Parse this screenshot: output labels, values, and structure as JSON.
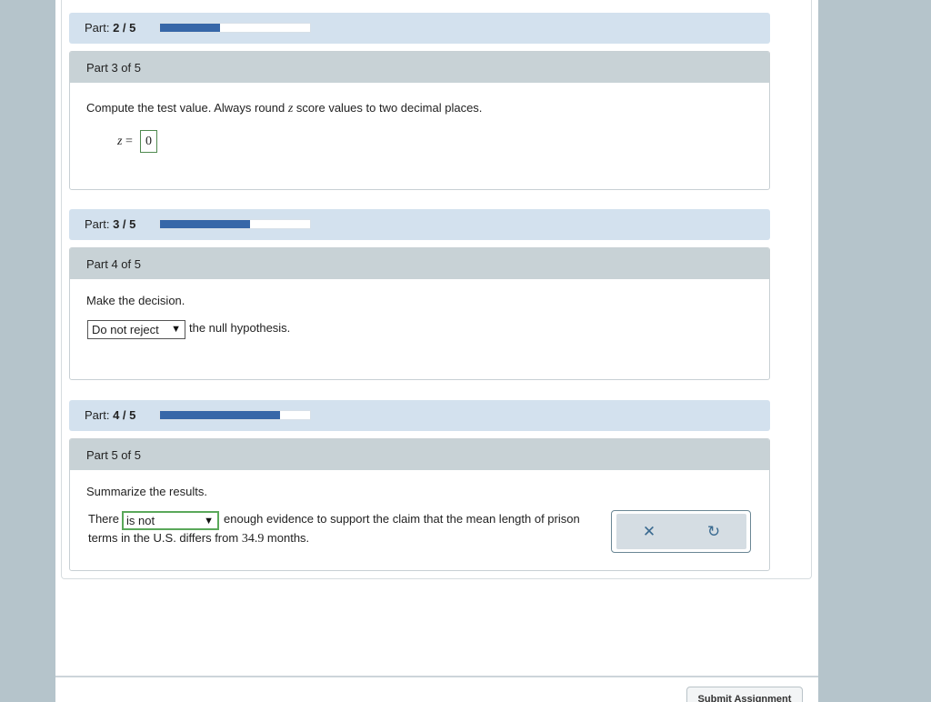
{
  "part_bars": [
    {
      "prefix": "Part: ",
      "value": "2 / 5",
      "progress": 0.4
    },
    {
      "prefix": "Part: ",
      "value": "3 / 5",
      "progress": 0.6
    },
    {
      "prefix": "Part: ",
      "value": "4 / 5",
      "progress": 0.8
    }
  ],
  "part3": {
    "header": "Part 3 of 5",
    "instruction_a": "Compute the test value. Always round ",
    "instruction_var": "z",
    "instruction_b": " score values to two decimal places.",
    "z_label": "z",
    "equals": " =",
    "z_value": "0"
  },
  "part4": {
    "header": "Part 4 of 5",
    "instruction": "Make the decision.",
    "decision_value": "Do not reject",
    "decision_suffix": "the null hypothesis."
  },
  "part5": {
    "header": "Part 5 of 5",
    "instruction": "Summarize the results.",
    "prefix": "There",
    "select_value": "is not",
    "line1_suffix": "enough evidence to support the claim that the mean length of prison",
    "line2_a": "terms in the U.S. differs from ",
    "line2_num": "34.9",
    "line2_b": " months."
  },
  "icons": {
    "clear": "close-icon",
    "undo": "undo-icon",
    "dropdown": "triangle-down-icon"
  },
  "footer": {
    "submit_label": "Submit Assignment"
  },
  "colors": {
    "progress_fill": "#3767a8",
    "part_bar_bg": "#d3e1ee",
    "answer_border": "#5aa85a"
  }
}
